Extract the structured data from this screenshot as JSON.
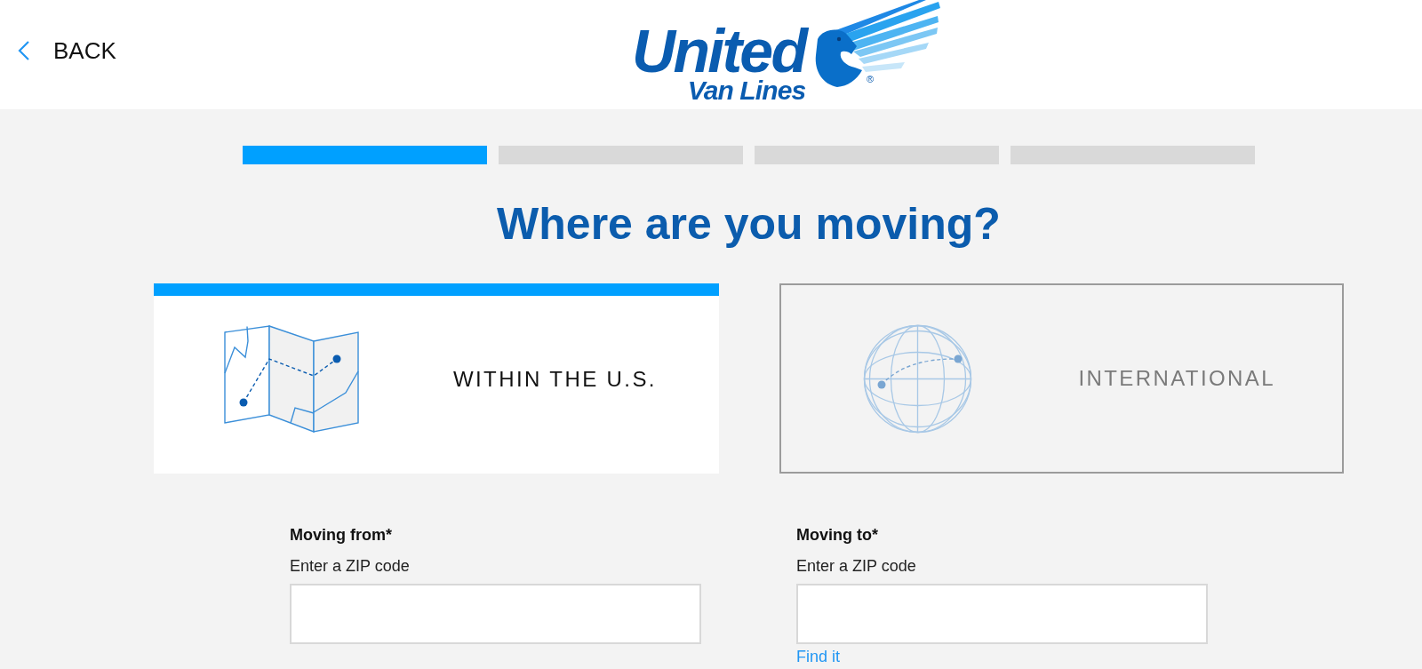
{
  "header": {
    "back_label": "BACK",
    "logo": {
      "wordmark": "United",
      "tagline": "Van Lines",
      "registered_mark": "®"
    }
  },
  "progress": {
    "steps": [
      {
        "active": true
      },
      {
        "active": false
      },
      {
        "active": false
      },
      {
        "active": false
      }
    ]
  },
  "title": "Where are you moving?",
  "move_types": [
    {
      "kind": "map",
      "label": "WITHIN THE U.S.",
      "selected": true
    },
    {
      "kind": "globe",
      "label": "INTERNATIONAL",
      "selected": false
    }
  ],
  "fields": [
    {
      "label": "Moving from*",
      "hint": "Enter a ZIP code"
    },
    {
      "label": "Moving to*",
      "hint": "Enter a ZIP code",
      "link": "Find it"
    }
  ]
}
